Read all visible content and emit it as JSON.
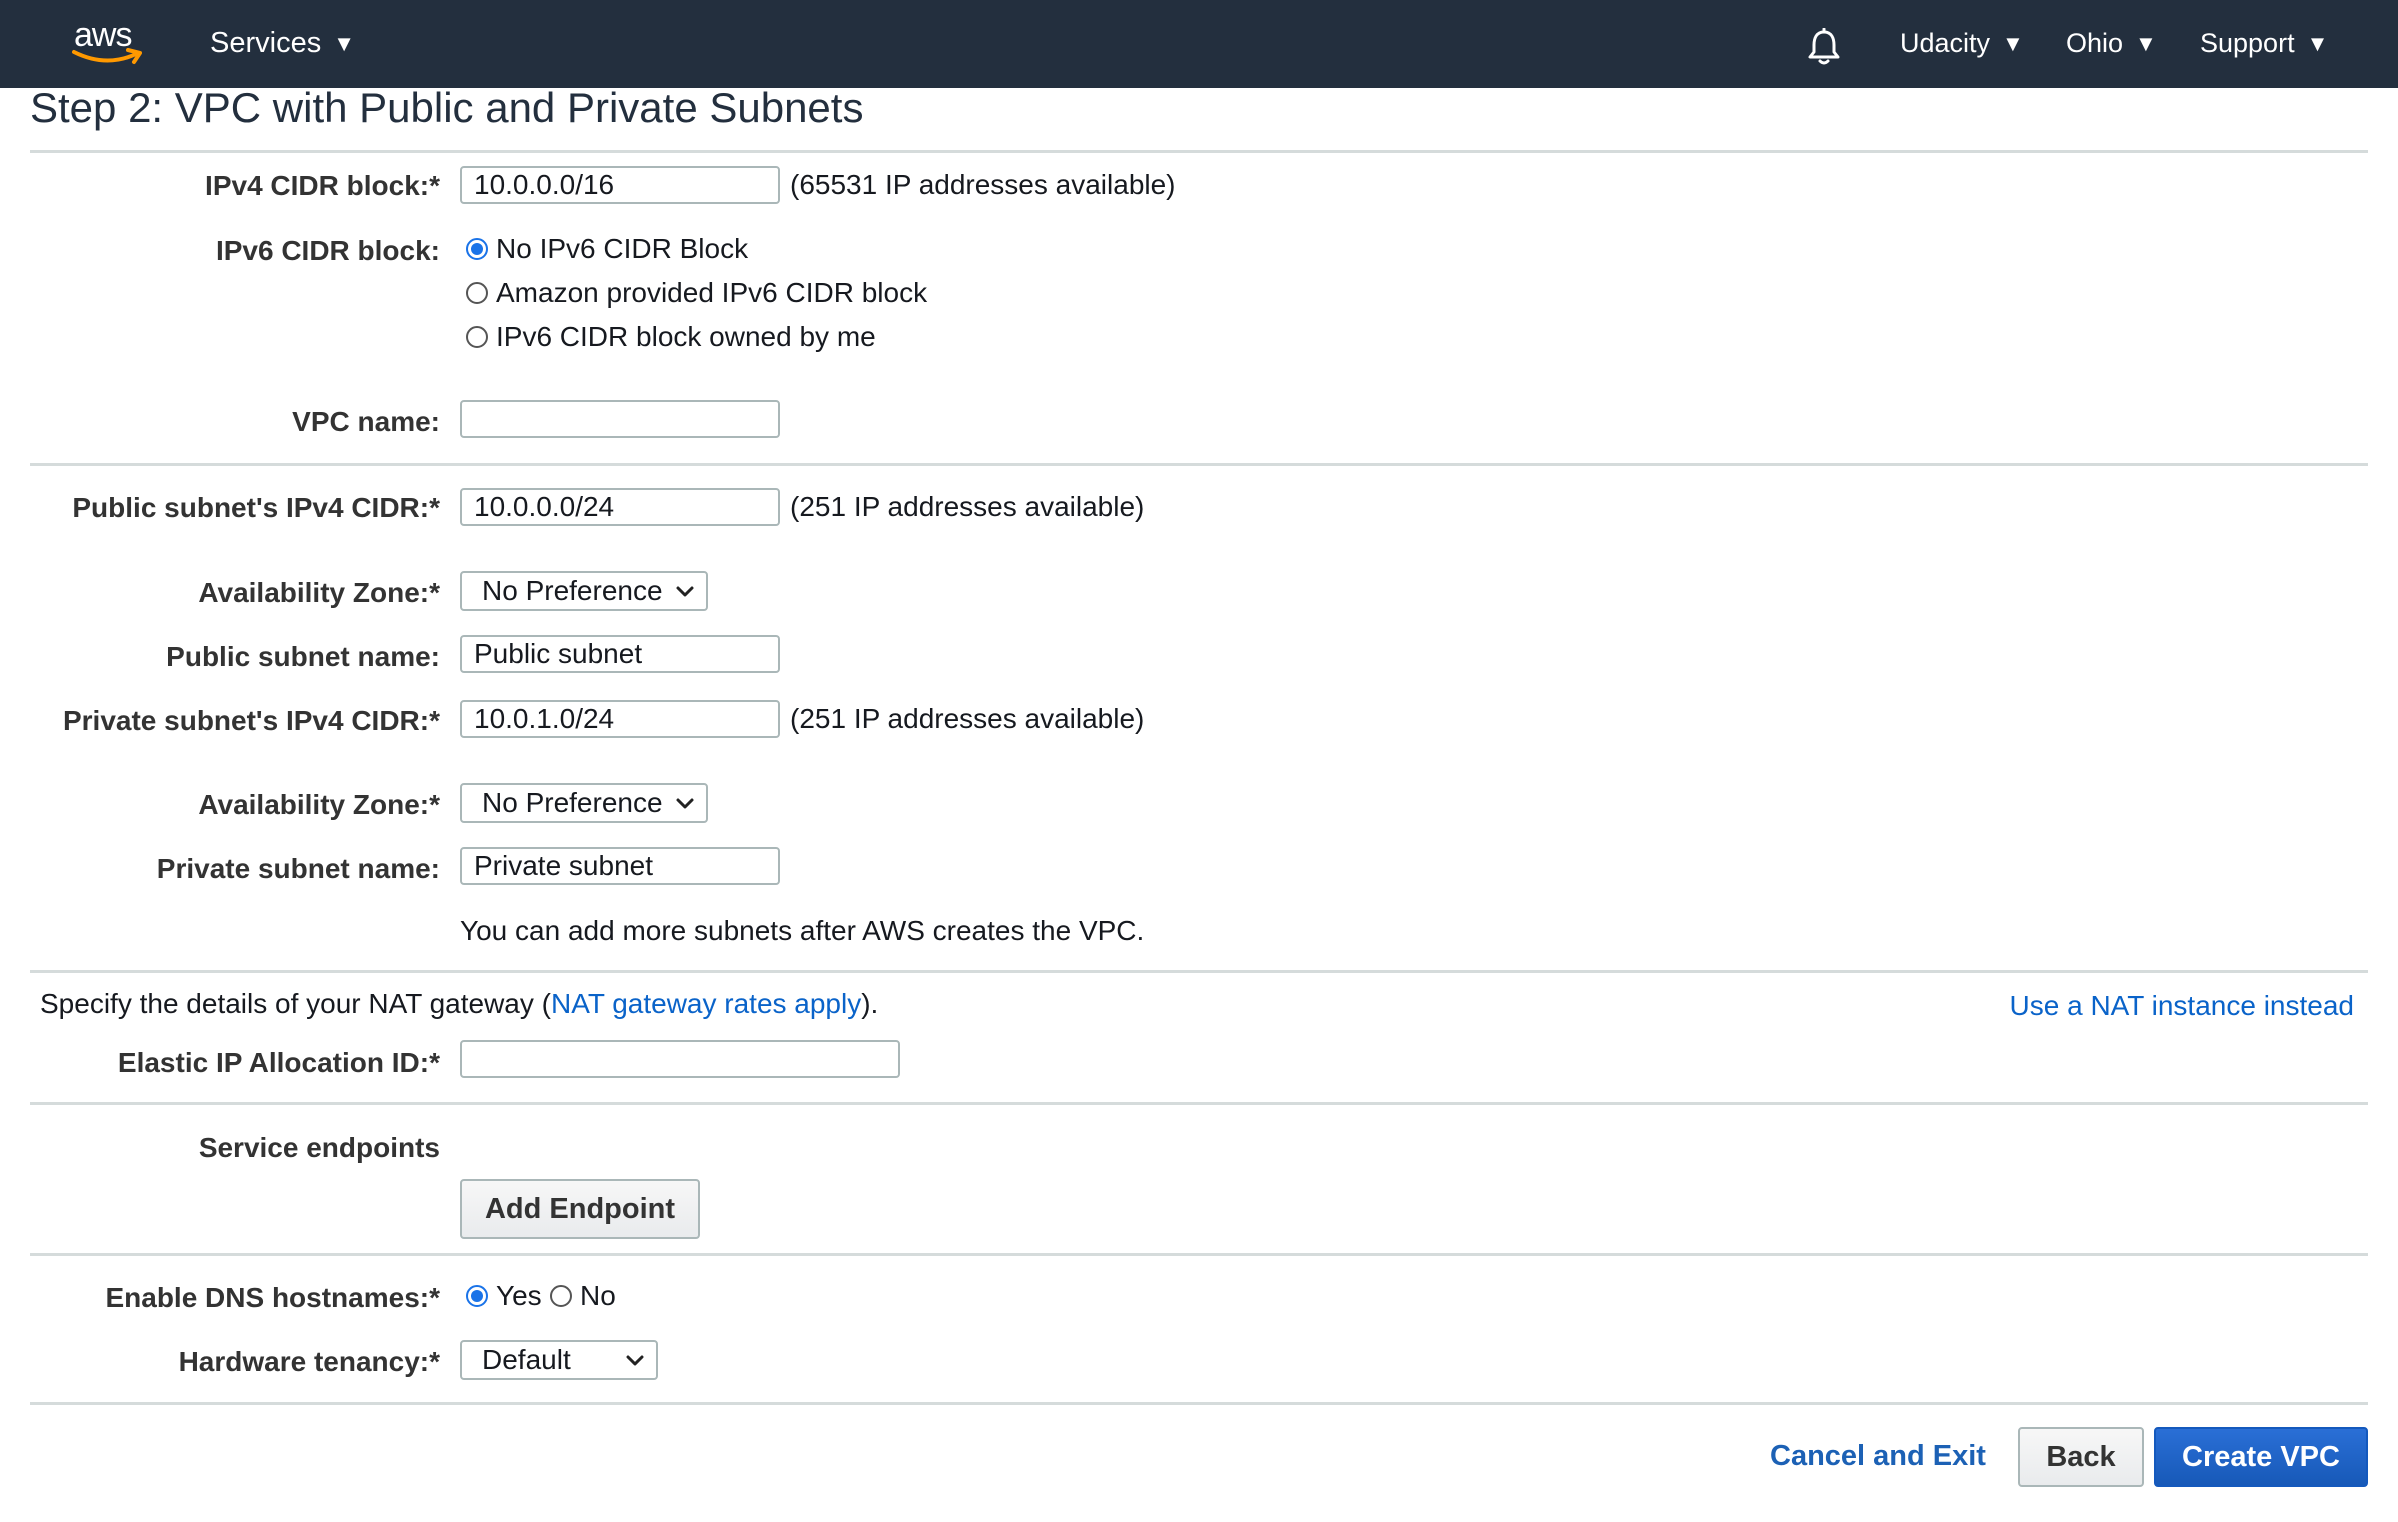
{
  "nav": {
    "logo_text": "aws",
    "services_label": "Services",
    "account_label": "Udacity",
    "region_label": "Ohio",
    "support_label": "Support"
  },
  "page": {
    "title": "Step 2: VPC with Public and Private Subnets"
  },
  "form": {
    "ipv4_cidr": {
      "label": "IPv4 CIDR block:*",
      "value": "10.0.0.0/16",
      "hint": "(65531 IP addresses available)"
    },
    "ipv6_cidr": {
      "label": "IPv6 CIDR block:",
      "options": [
        "No IPv6 CIDR Block",
        "Amazon provided IPv6 CIDR block",
        "IPv6 CIDR block owned by me"
      ],
      "selected": "No IPv6 CIDR Block"
    },
    "vpc_name": {
      "label": "VPC name:",
      "value": ""
    },
    "public_cidr": {
      "label": "Public subnet's IPv4 CIDR:*",
      "value": "10.0.0.0/24",
      "hint": "(251 IP addresses available)"
    },
    "public_az": {
      "label": "Availability Zone:*",
      "value": "No Preference"
    },
    "public_name": {
      "label": "Public subnet name:",
      "value": "Public subnet"
    },
    "private_cidr": {
      "label": "Private subnet's IPv4 CIDR:*",
      "value": "10.0.1.0/24",
      "hint": "(251 IP addresses available)"
    },
    "private_az": {
      "label": "Availability Zone:*",
      "value": "No Preference"
    },
    "private_name": {
      "label": "Private subnet name:",
      "value": "Private subnet"
    },
    "subnets_note": "You can add more subnets after AWS creates the VPC.",
    "nat": {
      "text_before": "Specify the details of your NAT gateway (",
      "link": "NAT gateway rates apply",
      "text_after": ").",
      "alt_link": "Use a NAT instance instead"
    },
    "eip": {
      "label": "Elastic IP Allocation ID:*",
      "value": ""
    },
    "endpoints": {
      "label": "Service endpoints",
      "button": "Add Endpoint"
    },
    "dns": {
      "label": "Enable DNS hostnames:*",
      "yes": "Yes",
      "no": "No",
      "selected": "Yes"
    },
    "tenancy": {
      "label": "Hardware tenancy:*",
      "value": "Default"
    }
  },
  "footer": {
    "cancel": "Cancel and Exit",
    "back": "Back",
    "create": "Create VPC"
  },
  "colors": {
    "nav_bg": "#232f3e",
    "primary": "#1759b8",
    "link": "#0a63c9"
  }
}
